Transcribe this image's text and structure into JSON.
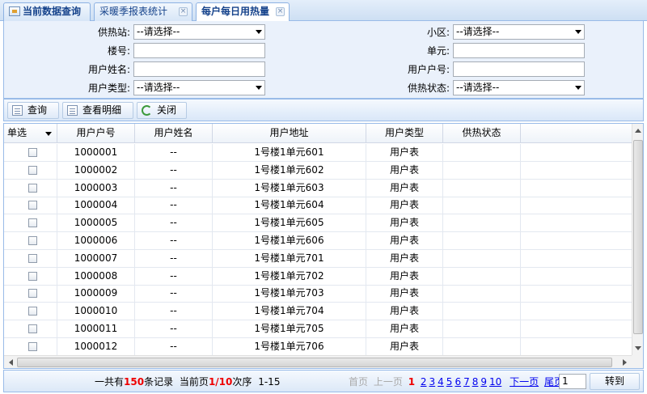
{
  "tabs": [
    {
      "label": "当前数据查询",
      "has_icon": true,
      "closable": false,
      "active": false
    },
    {
      "label": "采暖季报表统计",
      "has_icon": false,
      "closable": true,
      "active": false
    },
    {
      "label": "每户每日用热量",
      "has_icon": false,
      "closable": true,
      "active": true
    }
  ],
  "close_glyph": "×",
  "form": {
    "heating_station": {
      "label": "供热站:",
      "value": "--请选择--"
    },
    "district": {
      "label": "小区:",
      "value": "--请选择--"
    },
    "building": {
      "label": "楼号:",
      "value": ""
    },
    "unit": {
      "label": "单元:",
      "value": ""
    },
    "user_name": {
      "label": "用户姓名:",
      "value": ""
    },
    "user_number": {
      "label": "用户户号:",
      "value": ""
    },
    "user_type": {
      "label": "用户类型:",
      "value": "--请选择--"
    },
    "heating_status": {
      "label": "供热状态:",
      "value": "--请选择--"
    }
  },
  "toolbar": {
    "query_label": "查询",
    "detail_label": "查看明细",
    "close_label": "关闭"
  },
  "grid": {
    "select_mode": "单选",
    "columns": [
      "用户户号",
      "用户姓名",
      "用户地址",
      "用户类型",
      "供热状态"
    ],
    "rows": [
      {
        "number": "1000001",
        "name": "--",
        "address": "1号楼1单元601",
        "type": "用户表",
        "status": ""
      },
      {
        "number": "1000002",
        "name": "--",
        "address": "1号楼1单元602",
        "type": "用户表",
        "status": ""
      },
      {
        "number": "1000003",
        "name": "--",
        "address": "1号楼1单元603",
        "type": "用户表",
        "status": ""
      },
      {
        "number": "1000004",
        "name": "--",
        "address": "1号楼1单元604",
        "type": "用户表",
        "status": ""
      },
      {
        "number": "1000005",
        "name": "--",
        "address": "1号楼1单元605",
        "type": "用户表",
        "status": ""
      },
      {
        "number": "1000006",
        "name": "--",
        "address": "1号楼1单元606",
        "type": "用户表",
        "status": ""
      },
      {
        "number": "1000007",
        "name": "--",
        "address": "1号楼1单元701",
        "type": "用户表",
        "status": ""
      },
      {
        "number": "1000008",
        "name": "--",
        "address": "1号楼1单元702",
        "type": "用户表",
        "status": ""
      },
      {
        "number": "1000009",
        "name": "--",
        "address": "1号楼1单元703",
        "type": "用户表",
        "status": ""
      },
      {
        "number": "1000010",
        "name": "--",
        "address": "1号楼1单元704",
        "type": "用户表",
        "status": ""
      },
      {
        "number": "1000011",
        "name": "--",
        "address": "1号楼1单元705",
        "type": "用户表",
        "status": ""
      },
      {
        "number": "1000012",
        "name": "--",
        "address": "1号楼1单元706",
        "type": "用户表",
        "status": ""
      }
    ]
  },
  "pager": {
    "total_prefix": "一共有",
    "total": "150",
    "total_suffix": "条记录",
    "current_prefix": "当前页",
    "current_page": "1/10",
    "order_label": "次序",
    "range": "1-15",
    "first_label": "首页",
    "prev_label": "上一页",
    "current_link": "1",
    "page_links": [
      "2",
      "3",
      "4",
      "5",
      "6",
      "7",
      "8",
      "9",
      "10"
    ],
    "next_label": "下一页",
    "last_label": "尾页",
    "goto_value": "1",
    "goto_label": "转到"
  },
  "colors": {
    "accent_border": "#99bbe8",
    "tab_text": "#15428b",
    "highlight_red": "#ee0000",
    "link_blue": "#0000ee"
  },
  "icons": [
    "tab-home-icon",
    "tab-close-icon",
    "query-doc-icon",
    "detail-doc-icon",
    "close-refresh-icon",
    "select-dropdown-icon"
  ]
}
